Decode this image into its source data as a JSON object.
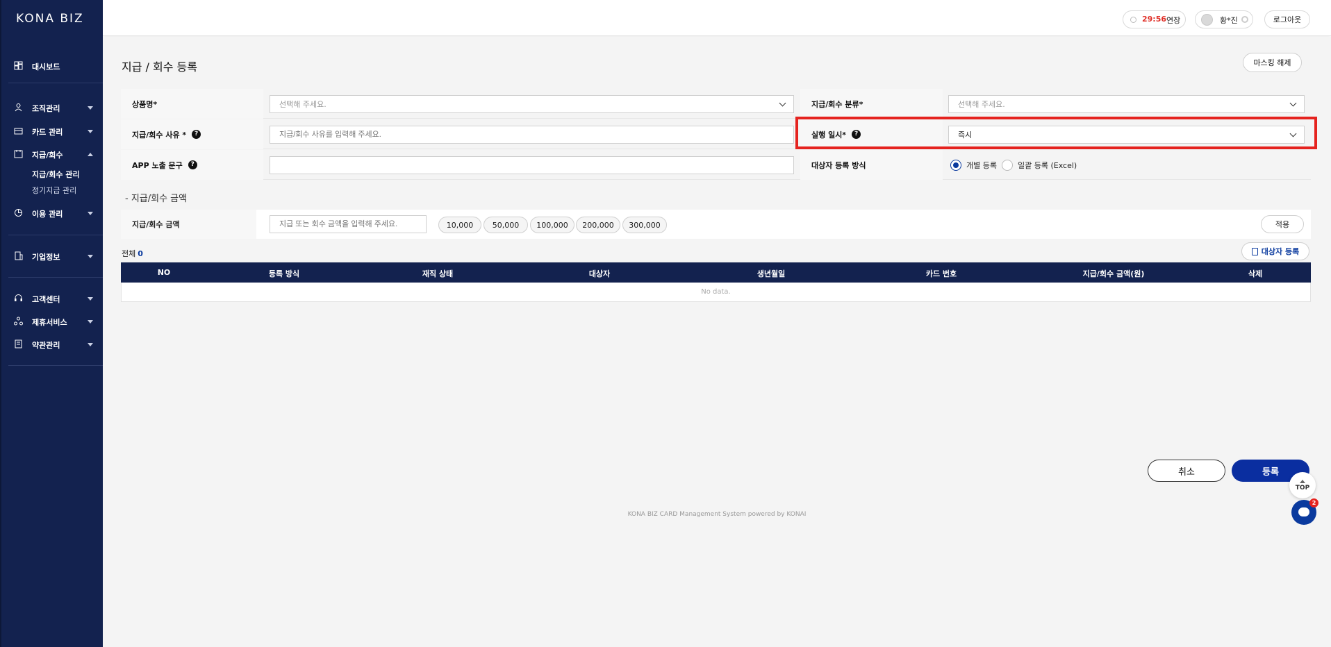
{
  "app": {
    "logo": "KONA BIZ"
  },
  "header": {
    "timer": "29:56",
    "extend_label": "연장",
    "user_name": "황*진",
    "logout_label": "로그아웃"
  },
  "sidebar": {
    "items": [
      {
        "label": "대시보드",
        "icon": "dashboard-icon"
      },
      {
        "label": "조직관리",
        "icon": "org-icon"
      },
      {
        "label": "카드 관리",
        "icon": "card-icon"
      },
      {
        "label": "지급/회수",
        "icon": "payment-icon"
      },
      {
        "label": "이용 관리",
        "icon": "usage-icon"
      },
      {
        "label": "기업정보",
        "icon": "company-icon"
      },
      {
        "label": "고객센터",
        "icon": "headset-icon"
      },
      {
        "label": "제휴서비스",
        "icon": "partner-icon"
      },
      {
        "label": "약관관리",
        "icon": "terms-icon"
      }
    ],
    "sub_items": [
      {
        "label": "지급/회수 관리",
        "active": true
      },
      {
        "label": "정기지급 관리",
        "active": false
      }
    ]
  },
  "page": {
    "title": "지급 / 회수 등록",
    "mask_button": "마스킹 해제"
  },
  "form": {
    "product_label": "상품명*",
    "product_placeholder": "선택해 주세요.",
    "category_label": "지급/회수 분류*",
    "category_placeholder": "선택해 주세요.",
    "reason_label": "지급/회수 사유 *",
    "reason_placeholder": "지급/회수 사유를 입력해 주세요.",
    "exec_label": "실행 일시*",
    "exec_value": "즉시",
    "app_text_label": "APP 노출 문구",
    "app_text_value": "",
    "target_method_label": "대상자 등록 방식",
    "radio_individual": "개별 등록",
    "radio_bulk": "일괄 등록 (Excel)"
  },
  "amount": {
    "section_title": "- 지급/회수 금액",
    "label": "지급/회수 금액",
    "placeholder": "지급 또는 회수 금액을 입력해 주세요.",
    "chips": [
      "10,000",
      "50,000",
      "100,000",
      "200,000",
      "300,000"
    ],
    "apply_label": "적용"
  },
  "list": {
    "total_label": "전체",
    "total_count": "0",
    "register_target_label": "대상자 등록",
    "columns": [
      "NO",
      "등록 방식",
      "재직 상태",
      "대상자",
      "생년월일",
      "카드 번호",
      "지급/회수 금액(원)",
      "삭제"
    ],
    "empty_text": "No data."
  },
  "actions": {
    "cancel_label": "취소",
    "submit_label": "등록",
    "top_label": "TOP",
    "chat_badge": "2"
  },
  "footer": {
    "text": "KONA BIZ CARD Management System powered by KONAI"
  },
  "colors": {
    "brand_navy": "#13224f",
    "primary": "#0a2ea0",
    "highlight": "#e5231f",
    "timer": "#e0322a"
  }
}
